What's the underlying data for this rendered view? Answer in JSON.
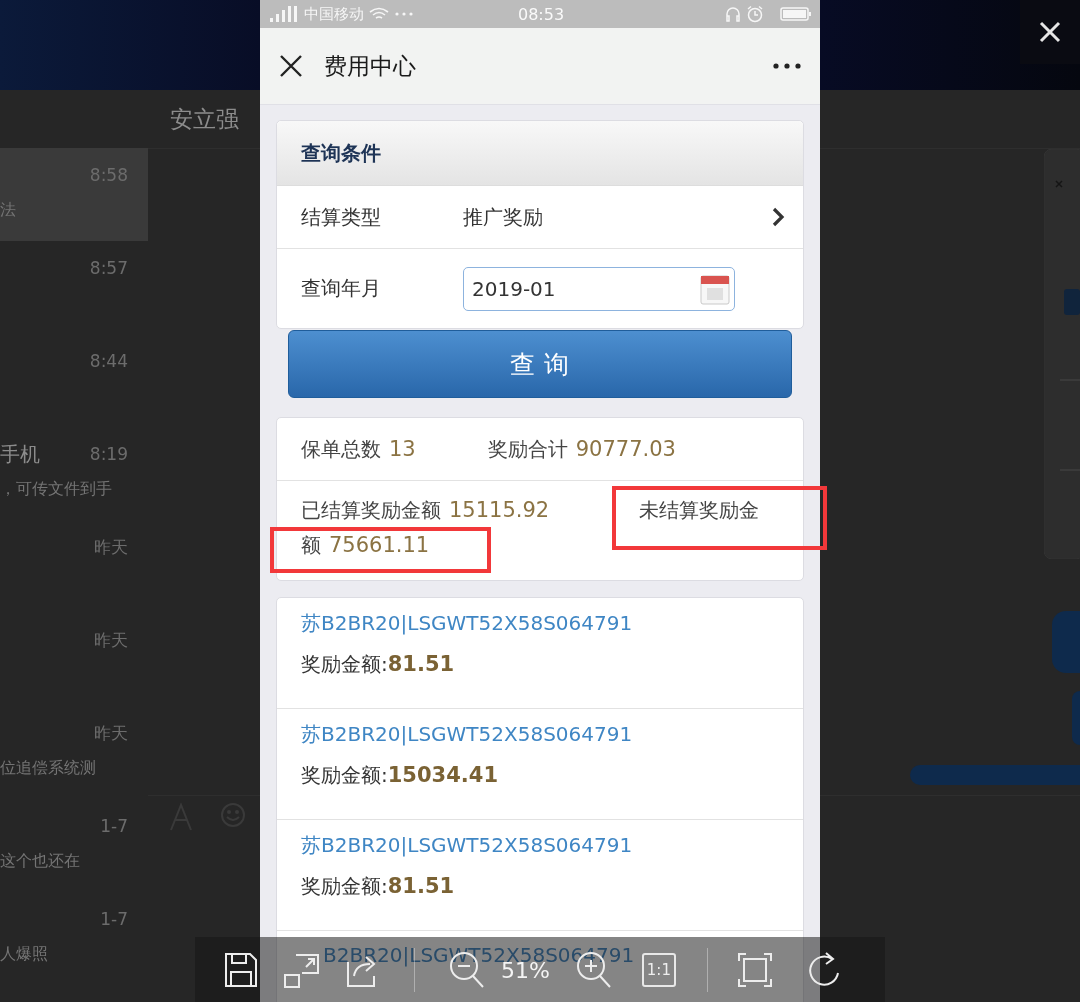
{
  "background_app": {
    "chat_list": [
      {
        "time": "8:58",
        "snippet": "法",
        "selected": true
      },
      {
        "time": "8:57",
        "selected": false
      },
      {
        "time": "8:44",
        "selected": false
      },
      {
        "time": "8:19",
        "title": "手机",
        "snippet": "，可传文件到手",
        "selected": false
      },
      {
        "time": "昨天",
        "selected": false
      },
      {
        "time": "昨天",
        "selected": false
      },
      {
        "time": "昨天",
        "snippet": "位追偿系统测",
        "selected": false
      },
      {
        "time": "1-7",
        "snippet": "这个也还在",
        "selected": false
      },
      {
        "time": "1-7",
        "snippet": "人爆照",
        "selected": false
      }
    ],
    "chat_title": "安立强"
  },
  "phone": {
    "status_bar": {
      "carrier": "中国移动",
      "time": "08:53"
    },
    "nav_bar": {
      "title": "费用中心"
    },
    "query": {
      "title": "查询条件",
      "rows": [
        {
          "kind": "select",
          "label": "结算类型",
          "value": "推广奖励"
        },
        {
          "kind": "date",
          "label": "查询年月",
          "value": "2019-01"
        }
      ],
      "button": "查 询"
    },
    "summary": {
      "rows": [
        {
          "items": [
            {
              "label": "保单总数",
              "value": "13"
            },
            {
              "label": "奖励合计",
              "value": "90777.03"
            }
          ]
        },
        {
          "items": [
            {
              "label": "已结算奖励金额",
              "value": "15115.92"
            },
            {
              "label_start": "未结算奖励金",
              "label": "额",
              "value": "75661.11"
            }
          ]
        }
      ]
    },
    "records": [
      {
        "kind": "full",
        "title": "苏B2BR20|LSGWT52X58S064791",
        "label": "奖励金额:",
        "amount": "81.51"
      },
      {
        "kind": "full",
        "title": "苏B2BR20|LSGWT52X58S064791",
        "label": "奖励金额:",
        "amount": "15034.41"
      },
      {
        "kind": "full",
        "title": "苏B2BR20|LSGWT52X58S064791",
        "label": "奖励金额:",
        "amount": "81.51"
      },
      {
        "kind": "cut",
        "title": "B2BR20|LSGWT52X58S064791"
      }
    ]
  },
  "viewer_toolbar": {
    "zoom": "51%",
    "actual_size": "1:1"
  }
}
